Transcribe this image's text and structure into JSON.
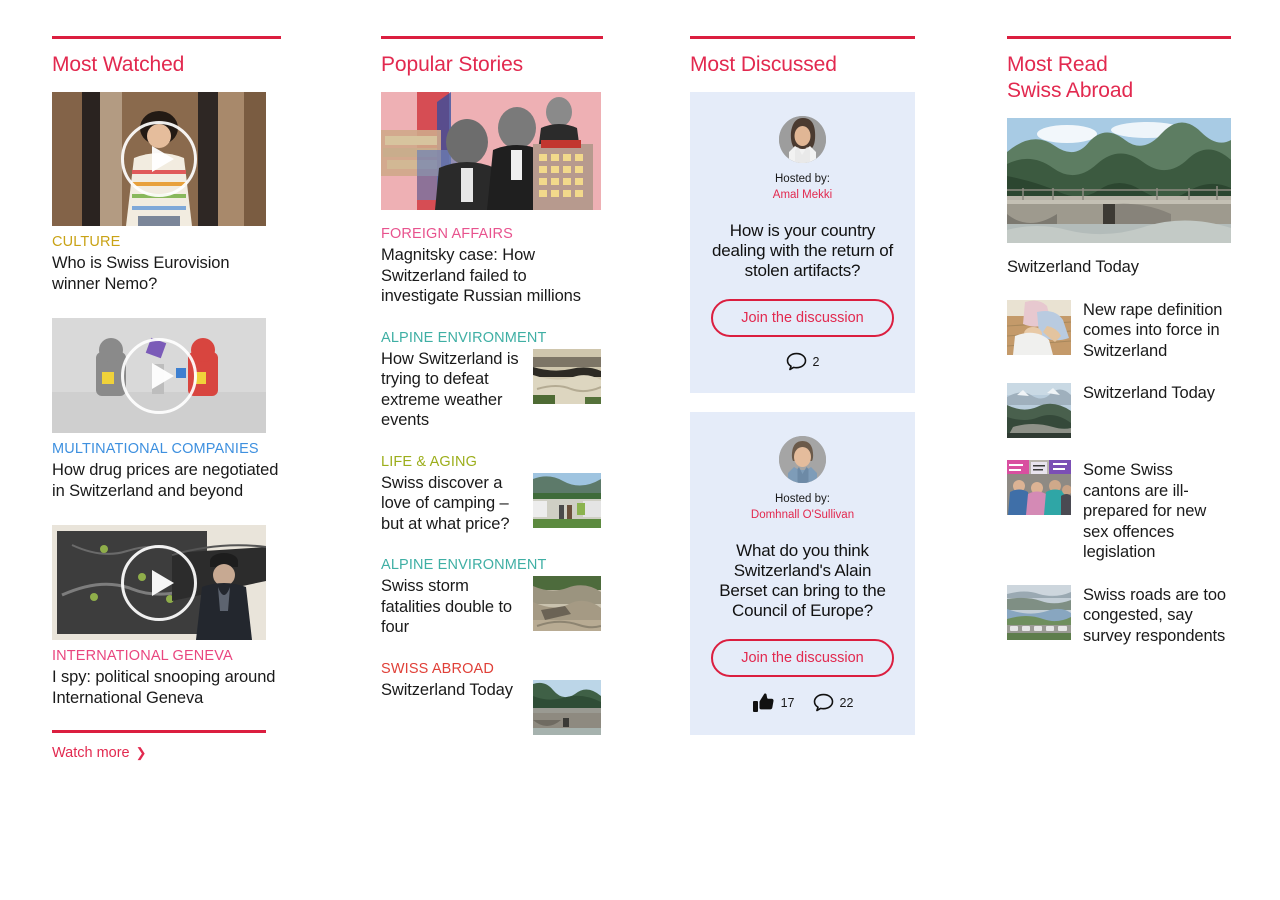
{
  "theme": {
    "brand_red": "#DB1E3F",
    "title_red": "#E2294F",
    "card_bg": "#E5ECF9",
    "text": "#1a1a1a"
  },
  "columns": {
    "most_watched": {
      "title": "Most Watched",
      "items": [
        {
          "kicker": "CULTURE",
          "kicker_color": "#C9A316",
          "headline": "Who is Swiss Eurovision winner Nemo?",
          "media": "video"
        },
        {
          "kicker": "MULTINATIONAL COMPANIES",
          "kicker_color": "#3E90DF",
          "headline": "How drug prices are negotiated in Switzerland and beyond",
          "media": "video"
        },
        {
          "kicker": "INTERNATIONAL GENEVA",
          "kicker_color": "#E9467F",
          "headline": "I spy: political snooping around International Geneva",
          "media": "video"
        }
      ],
      "watch_more": "Watch more",
      "watch_more_icon": "chevron-right-icon"
    },
    "popular_stories": {
      "title": "Popular Stories",
      "lead": {
        "kicker": "FOREIGN AFFAIRS",
        "kicker_color": "#E8538E",
        "headline": "Magnitsky case:  How Switzerland failed to investigate Russian millions"
      },
      "items": [
        {
          "kicker": "ALPINE ENVIRONMENT",
          "kicker_color": "#3FAFA4",
          "headline": "How Switzerland is trying to defeat extreme weather events"
        },
        {
          "kicker": "LIFE & AGING",
          "kicker_color": "#9CAE1B",
          "headline": "Swiss discover a love of camping – but at what price?"
        },
        {
          "kicker": "ALPINE ENVIRONMENT",
          "kicker_color": "#3FAFA4",
          "headline": "Swiss storm fatalities double to four"
        },
        {
          "kicker": "SWISS ABROAD",
          "kicker_color": "#E04038",
          "headline": "Switzerland Today"
        }
      ]
    },
    "most_discussed": {
      "title": "Most Discussed",
      "hosted_by_label": "Hosted by:",
      "cards": [
        {
          "host": "Amal Mekki",
          "question": "How is your country dealing with the return of stolen artifacts?",
          "button": "Join the discussion",
          "likes": null,
          "comments": "2"
        },
        {
          "host": "Domhnall O'Sullivan",
          "question": "What do you think Switzerland's Alain Berset can bring to the Council of Europe?",
          "button": "Join the discussion",
          "likes": "17",
          "comments": "22"
        }
      ]
    },
    "most_read_swiss_abroad": {
      "title_line1": "Most Read",
      "title_line2": "Swiss Abroad",
      "lead": {
        "title": "Switzerland Today"
      },
      "items": [
        {
          "title": "New rape definition comes into force in Switzerland"
        },
        {
          "title": "Switzerland Today"
        },
        {
          "title": "Some Swiss cantons are ill-prepared for new sex offences legislation"
        },
        {
          "title": "Swiss roads are too congested, say survey respondents"
        }
      ]
    }
  }
}
